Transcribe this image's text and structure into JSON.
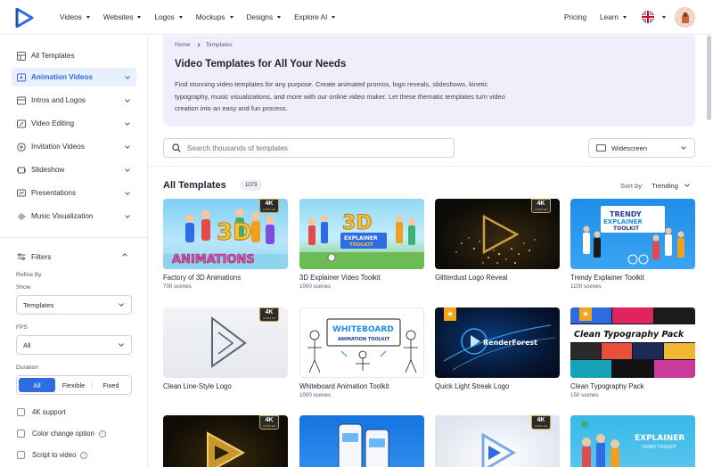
{
  "nav": {
    "items": [
      "Videos",
      "Websites",
      "Logos",
      "Mockups",
      "Designs",
      "Explore AI"
    ],
    "pricing": "Pricing",
    "learn": "Learn"
  },
  "sidebar": {
    "items": [
      {
        "label": "All Templates",
        "icon": "template-icon"
      },
      {
        "label": "Animation Videos",
        "icon": "video-play-icon"
      },
      {
        "label": "Intros and Logos",
        "icon": "film-icon"
      },
      {
        "label": "Video Editing",
        "icon": "edit-icon"
      },
      {
        "label": "Invitation Videos",
        "icon": "invitation-icon"
      },
      {
        "label": "Slideshow",
        "icon": "slideshow-icon"
      },
      {
        "label": "Presentations",
        "icon": "presentation-icon"
      },
      {
        "label": "Music Visualization",
        "icon": "waveform-icon"
      }
    ],
    "filters": "Filters",
    "refine_by": "Refine By",
    "show_label": "Show",
    "show_value": "Templates",
    "fps_label": "FPS",
    "fps_value": "All",
    "duration_label": "Duration",
    "duration_options": [
      "All",
      "Flexible",
      "Fixed"
    ],
    "checkboxes": [
      "4K support",
      "Color change option",
      "Script to video"
    ]
  },
  "hero": {
    "breadcrumb_home": "Home",
    "breadcrumb_current": "Templates",
    "title": "Video Templates for All Your Needs",
    "description": "Find stunning video templates for any purpose. Create animated promos, logo reveals, slideshows, kinetic typography, music visualizations, and more with our online video maker. Let these thematic templates turn video creation into an easy and fun process."
  },
  "search": {
    "placeholder": "Search thousands of templates"
  },
  "aspect": {
    "value": "Widescreen"
  },
  "listing": {
    "title": "All Templates",
    "count": "1073",
    "sort_label": "Sort by:",
    "sort_value": "Trending"
  },
  "cards": [
    {
      "title": "Factory of 3D Animations",
      "sub": "700 scenes",
      "thumb_text": "3D ANIMATIONS",
      "badge": "4K",
      "badge_sub": "ULTRA HD"
    },
    {
      "title": "3D Explainer Video Toolkit",
      "sub": "1000 scenes",
      "thumb_text": "3D EXPLAINER TOOLKIT",
      "badge": "",
      "badge_sub": ""
    },
    {
      "title": "Glitterdust Logo Reveal",
      "sub": "",
      "thumb_text": "",
      "badge": "4K",
      "badge_sub": "ULTRA HD"
    },
    {
      "title": "Trendy Explainer Toolkit",
      "sub": "1100 scenes",
      "thumb_text": "TRENDY EXPLAINER TOOLKIT",
      "badge": "",
      "badge_sub": ""
    },
    {
      "title": "Clean Line-Style Logo",
      "sub": "",
      "thumb_text": "",
      "badge": "4K",
      "badge_sub": "ULTRA HD"
    },
    {
      "title": "Whiteboard Animation Toolkit",
      "sub": "1000 scenes",
      "thumb_text": "WHITEBOARD ANIMATION TOOLKIT",
      "badge": "",
      "badge_sub": ""
    },
    {
      "title": "Quick Light Streak Logo",
      "sub": "",
      "thumb_text": "RenderForest",
      "badge": "",
      "badge_sub": ""
    },
    {
      "title": "Clean Typography Pack",
      "sub": "150 scenes",
      "thumb_text": "Clean Typography Pack",
      "badge": "",
      "badge_sub": ""
    },
    {
      "title": "",
      "sub": "",
      "thumb_text": "",
      "badge": "4K",
      "badge_sub": "ULTRA HD"
    },
    {
      "title": "",
      "sub": "",
      "thumb_text": "",
      "badge": "",
      "badge_sub": ""
    },
    {
      "title": "",
      "sub": "",
      "thumb_text": "",
      "badge": "4K",
      "badge_sub": "ULTRA HD"
    },
    {
      "title": "",
      "sub": "",
      "thumb_text": "EXPLAINER VIDEO TOOLKIT",
      "badge": "",
      "badge_sub": ""
    }
  ],
  "colors": {
    "accent": "#2f6be3",
    "hero_bg": "#f1edfa",
    "star": "#f3a517"
  }
}
